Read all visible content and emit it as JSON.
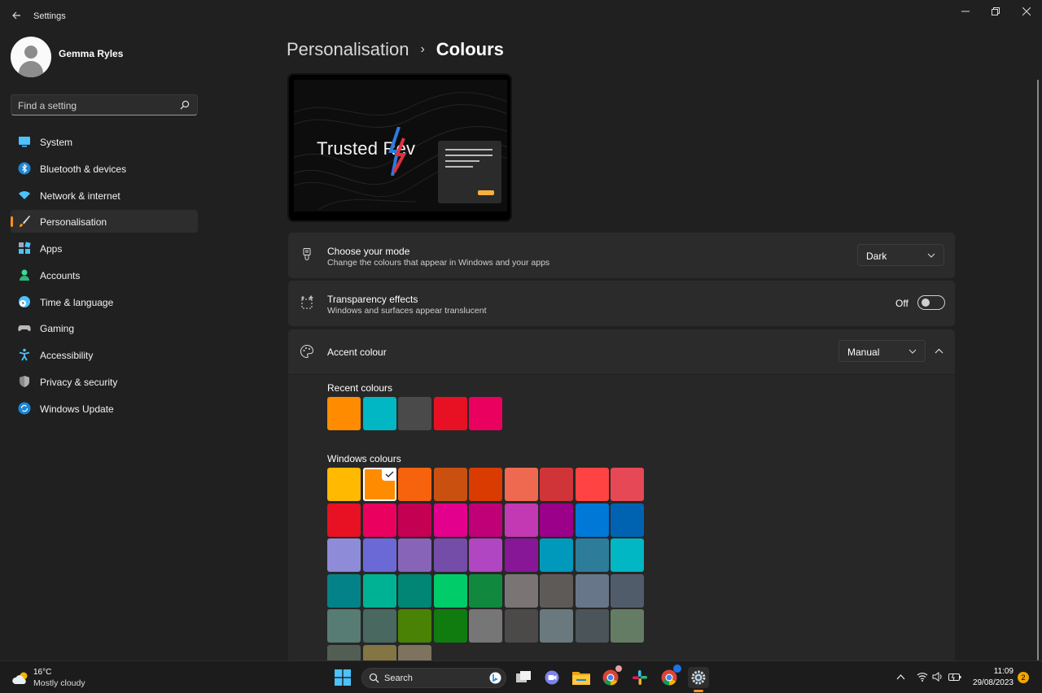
{
  "window": {
    "title": "Settings"
  },
  "profile": {
    "name": "Gemma Ryles"
  },
  "search": {
    "placeholder": "Find a setting"
  },
  "sidebar": {
    "items": [
      {
        "label": "System",
        "icon": "monitor-icon",
        "color": "#4cc2ff"
      },
      {
        "label": "Bluetooth & devices",
        "icon": "bluetooth-icon",
        "color": "#4cc2ff"
      },
      {
        "label": "Network & internet",
        "icon": "wifi-icon",
        "color": "#4cc2ff"
      },
      {
        "label": "Personalisation",
        "icon": "brush-icon",
        "color": "#f7911e",
        "active": true
      },
      {
        "label": "Apps",
        "icon": "apps-icon",
        "color": "#4cc2ff"
      },
      {
        "label": "Accounts",
        "icon": "person-icon",
        "color": "#3ddc97"
      },
      {
        "label": "Time & language",
        "icon": "globe-clock-icon",
        "color": "#4cc2ff"
      },
      {
        "label": "Gaming",
        "icon": "gamepad-icon",
        "color": "#b8b8b8"
      },
      {
        "label": "Accessibility",
        "icon": "accessibility-icon",
        "color": "#4cc2ff"
      },
      {
        "label": "Privacy & security",
        "icon": "shield-icon",
        "color": "#9a9a9a"
      },
      {
        "label": "Windows Update",
        "icon": "refresh-icon",
        "color": "#4cc2ff"
      }
    ]
  },
  "breadcrumb": {
    "parent": "Personalisation",
    "separator": "›",
    "current": "Colours"
  },
  "preview": {
    "logo_text": "Trusted Rev"
  },
  "mode": {
    "title": "Choose your mode",
    "subtitle": "Change the colours that appear in Windows and your apps",
    "value": "Dark"
  },
  "transparency": {
    "title": "Transparency effects",
    "subtitle": "Windows and surfaces appear translucent",
    "state_label": "Off",
    "enabled": false
  },
  "accent": {
    "title": "Accent colour",
    "value": "Manual",
    "recent_label": "Recent colours",
    "windows_label": "Windows colours",
    "recent_colours": [
      "#ff8c00",
      "#00b7c3",
      "#4a4a4a",
      "#e81123",
      "#ea005e"
    ],
    "windows_colours": [
      [
        "#ffb900",
        "#ff8c00",
        "#f7630c",
        "#ca5010",
        "#da3b01",
        "#ef6950",
        "#d13438",
        "#ff4343",
        "#e74856"
      ],
      [
        "#e81123",
        "#ea005e",
        "#c30052",
        "#e3008c",
        "#bf0077",
        "#c239b3",
        "#9a0089",
        "#0078d7",
        "#0063b1"
      ],
      [
        "#8e8cd8",
        "#6b69d6",
        "#8764b8",
        "#744da9",
        "#b146c2",
        "#881798",
        "#0099bc",
        "#2d7d9a",
        "#00b7c3"
      ],
      [
        "#038387",
        "#00b294",
        "#018574",
        "#00cc6a",
        "#10893e",
        "#7a7574",
        "#5d5a58",
        "#68768a",
        "#515c6b"
      ],
      [
        "#567c73",
        "#486860",
        "#498205",
        "#107c10",
        "#767676",
        "#4c4a48",
        "#69797e",
        "#4a5459",
        "#647c64"
      ],
      [
        "#525e54",
        "#847545",
        "#7e735f"
      ]
    ],
    "selected": {
      "row": 0,
      "col": 1
    }
  },
  "taskbar": {
    "weather_temp": "16°C",
    "weather_cond": "Mostly cloudy",
    "search_label": "Search",
    "time": "11:09",
    "date": "29/08/2023",
    "notification_count": "2",
    "accent": "#f7911e"
  }
}
